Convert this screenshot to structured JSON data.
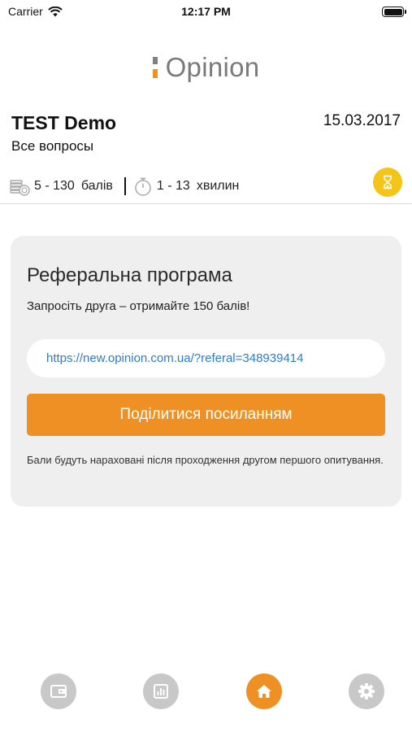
{
  "status_bar": {
    "carrier": "Carrier",
    "time": "12:17 PM"
  },
  "logo": {
    "text": "Opinion"
  },
  "survey": {
    "title": "TEST Demo",
    "date": "15.03.2017",
    "subtitle": "Все вопросы",
    "points": "5 - 130",
    "points_unit": "балів",
    "duration": "1 - 13",
    "duration_unit": "хвилин"
  },
  "referral": {
    "title": "Реферальна програма",
    "text": "Запросіть друга – отримайте 150 балів!",
    "link": "https://new.opinion.com.ua/?referal=348939414",
    "share_label": "Поділитися посиланням",
    "note": "Бали будуть нараховані після проходження другом першого опитування."
  },
  "tab_bar": {
    "items": [
      {
        "icon": "wallet-icon",
        "active": false
      },
      {
        "icon": "stats-icon",
        "active": false
      },
      {
        "icon": "home-icon",
        "active": true
      },
      {
        "icon": "gear-icon",
        "active": false
      }
    ]
  },
  "colors": {
    "accent": "#ef9024",
    "hourglass": "#f5c418",
    "link": "#2f7bd3",
    "card_bg": "#efefef",
    "inactive_tab": "#c8c8c8"
  }
}
